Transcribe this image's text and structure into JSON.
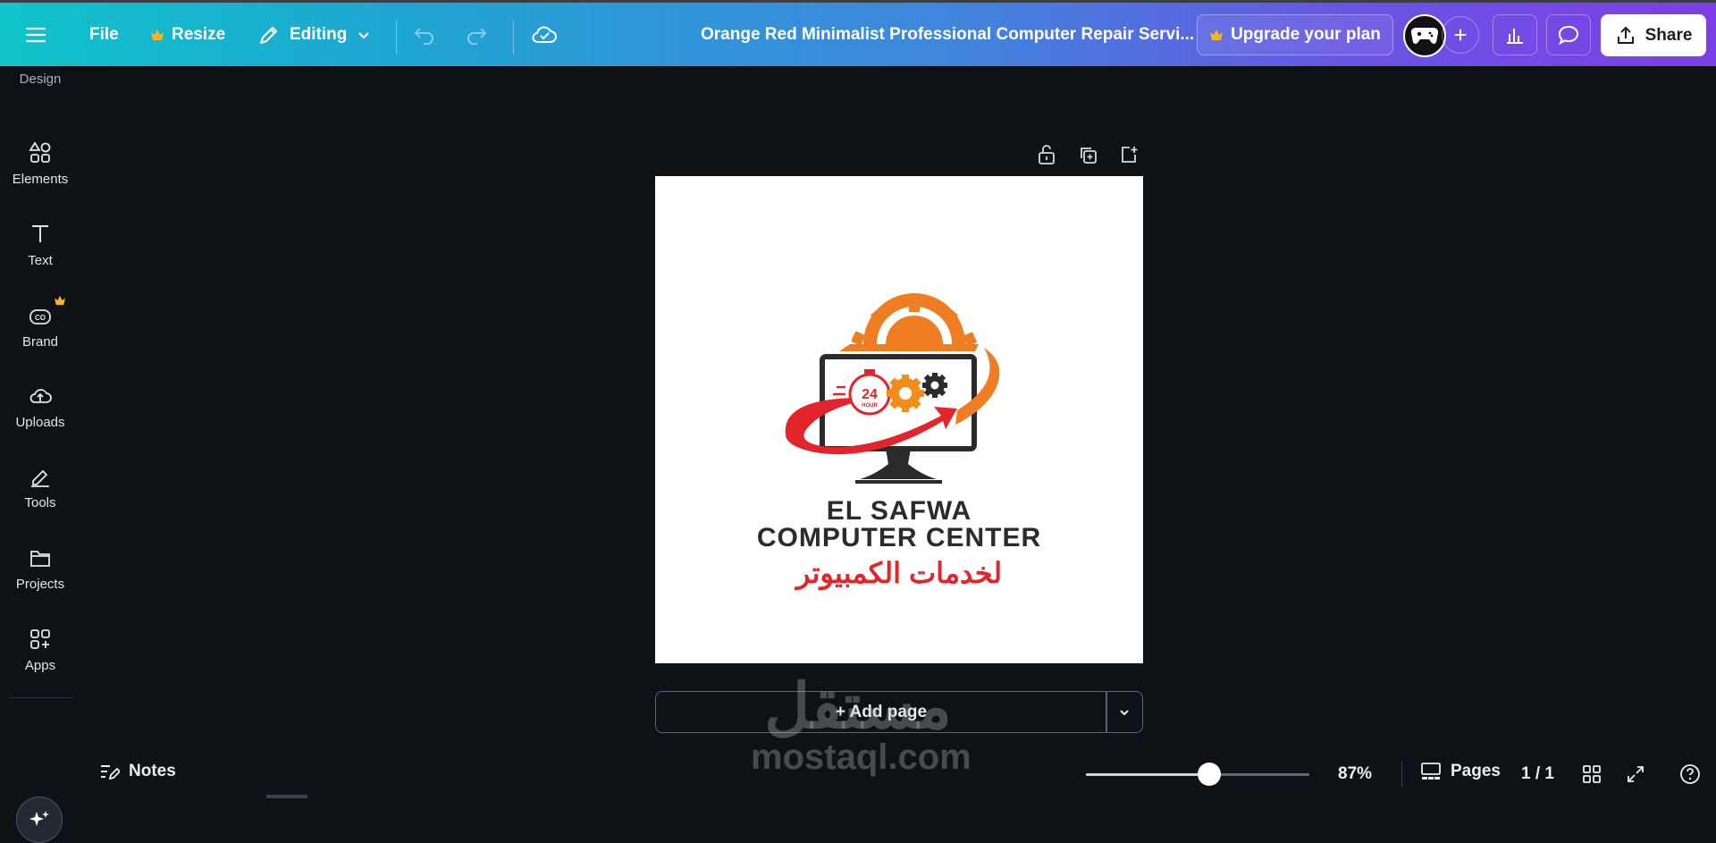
{
  "topbar": {
    "file_label": "File",
    "resize_label": "Resize",
    "editing_label": "Editing",
    "doc_title": "Orange Red Minimalist Professional Computer Repair Servi...",
    "upgrade_label": "Upgrade your plan",
    "share_label": "Share"
  },
  "sidebar": {
    "items": [
      {
        "label": "Design",
        "icon": "design-icon"
      },
      {
        "label": "Elements",
        "icon": "elements-icon"
      },
      {
        "label": "Text",
        "icon": "text-icon"
      },
      {
        "label": "Brand",
        "icon": "brand-icon"
      },
      {
        "label": "Uploads",
        "icon": "uploads-icon"
      },
      {
        "label": "Tools",
        "icon": "tools-icon"
      },
      {
        "label": "Projects",
        "icon": "projects-icon"
      },
      {
        "label": "Apps",
        "icon": "apps-icon"
      }
    ]
  },
  "canvas": {
    "logo_line1": "EL SAFWA",
    "logo_line2": "COMPUTER CENTER",
    "logo_arabic": "لخدمات الكمبيوتر",
    "badge_number": "24",
    "badge_caption": "HOUR",
    "add_page_label": "+ Add page"
  },
  "watermark": {
    "arabic": "مستقل",
    "latin": "mostaql.com"
  },
  "bottombar": {
    "notes_label": "Notes",
    "zoom_value": "87%",
    "zoom_level": 0.55,
    "pages_label": "Pages",
    "page_count": "1 / 1"
  },
  "colors": {
    "accent_orange": "#ef7d22",
    "accent_red": "#e3242b",
    "dark": "#2b2b2d"
  }
}
